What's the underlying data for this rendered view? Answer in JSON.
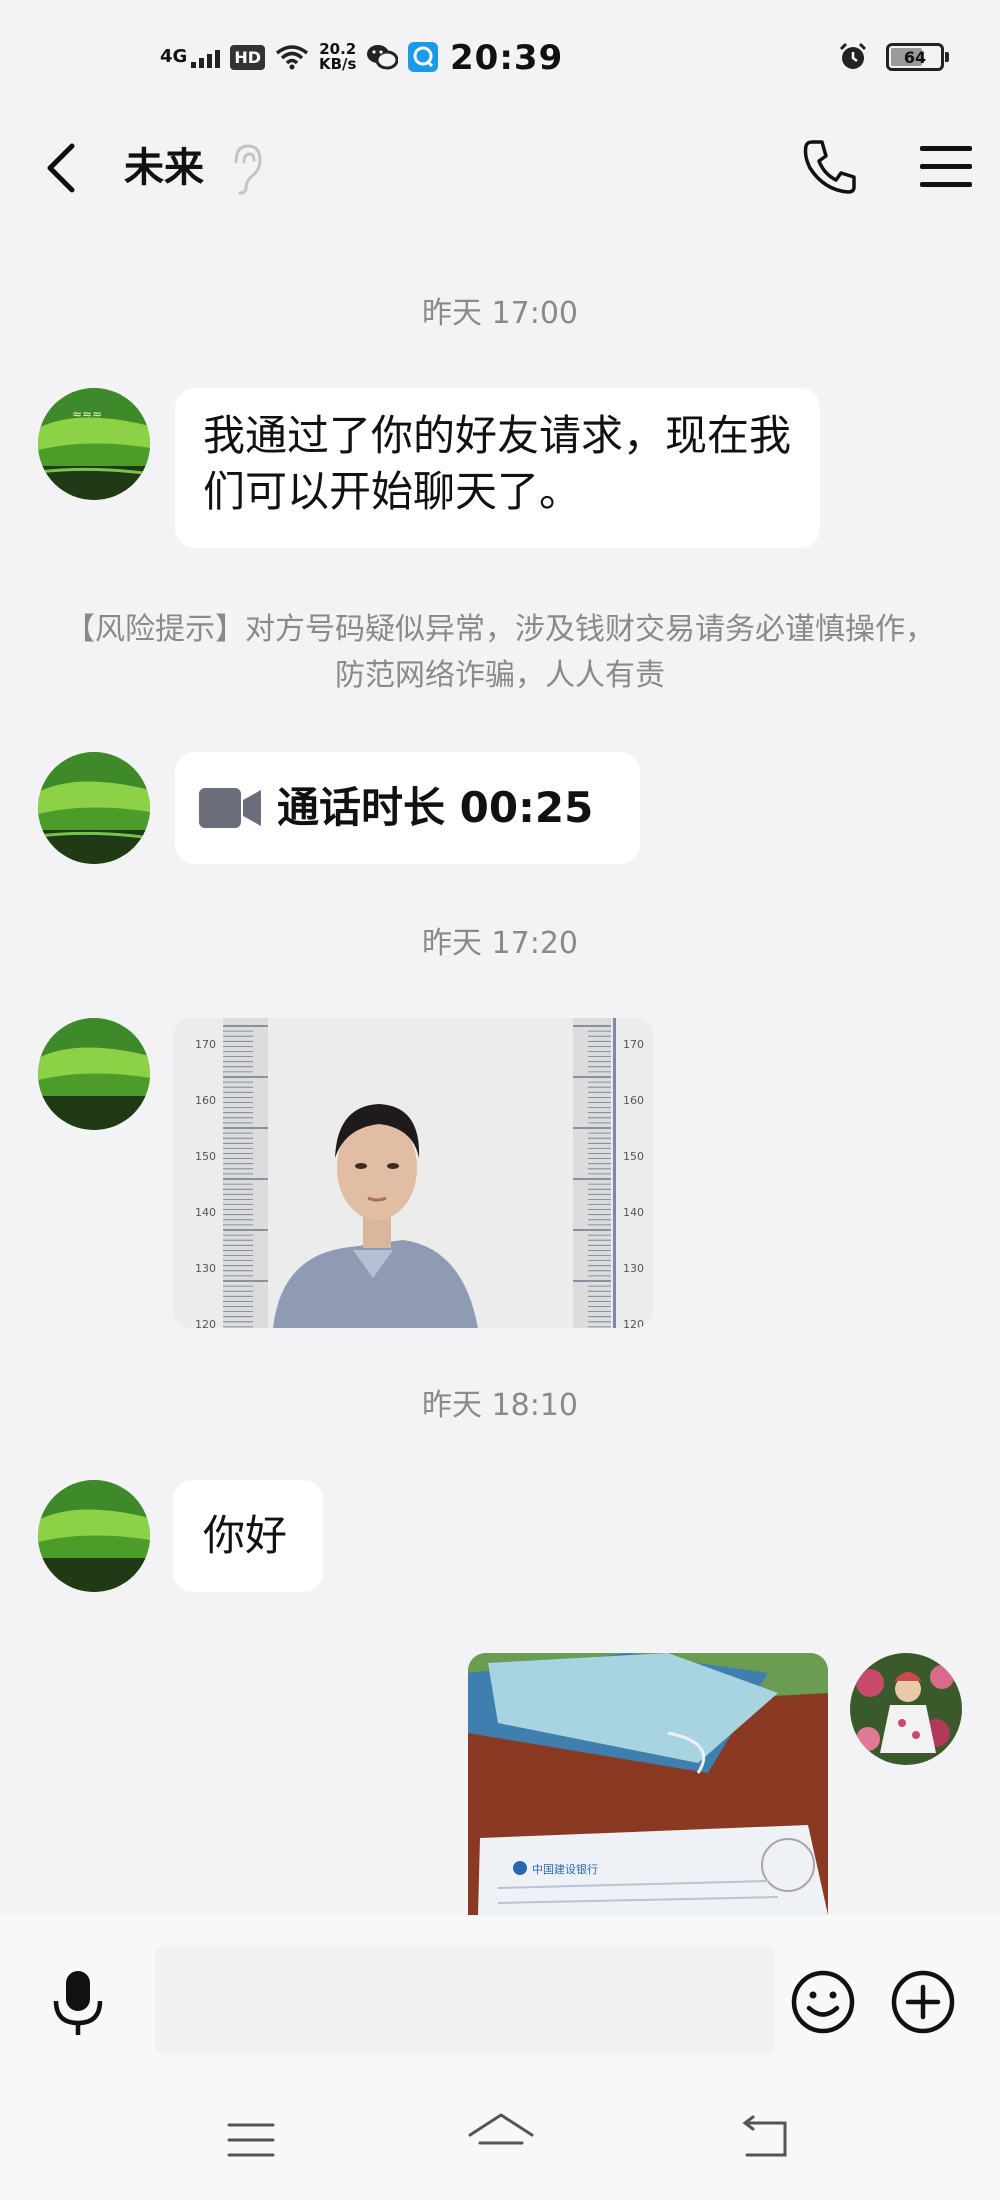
{
  "status_bar": {
    "network": "4G",
    "hd": "HD",
    "speed_value": "20.2",
    "speed_unit": "KB/s",
    "time": "20:39",
    "battery": "64",
    "battery_level": 0.64
  },
  "header": {
    "title": "未来",
    "icons": [
      "back-icon",
      "ear-icon",
      "phone-icon",
      "menu-icon"
    ]
  },
  "messages": {
    "ts1": "昨天 17:00",
    "msg1": "我通过了你的好友请求，现在我们可以开始聊天了。",
    "risk_notice": "【风险提示】对方号码疑似异常，涉及钱财交易请务必谨慎操作，防范网络诈骗，人人有责",
    "call_label": "通话时长 00:25",
    "ts2": "昨天 17:20",
    "height_chart_labels": [
      "170",
      "160",
      "150",
      "140",
      "130",
      "120"
    ],
    "ts3": "昨天 18:10",
    "msg_hello": "你好",
    "receipt_text": "中国建设银行"
  },
  "input": {
    "placeholder": "",
    "icons": [
      "microphone-icon",
      "emoji-icon",
      "plus-icon"
    ]
  },
  "colors": {
    "background": "#f3f3f5",
    "bubble": "#ffffff",
    "timestamp_text": "#8a8a8a",
    "video_icon": "#6b6e7a"
  }
}
